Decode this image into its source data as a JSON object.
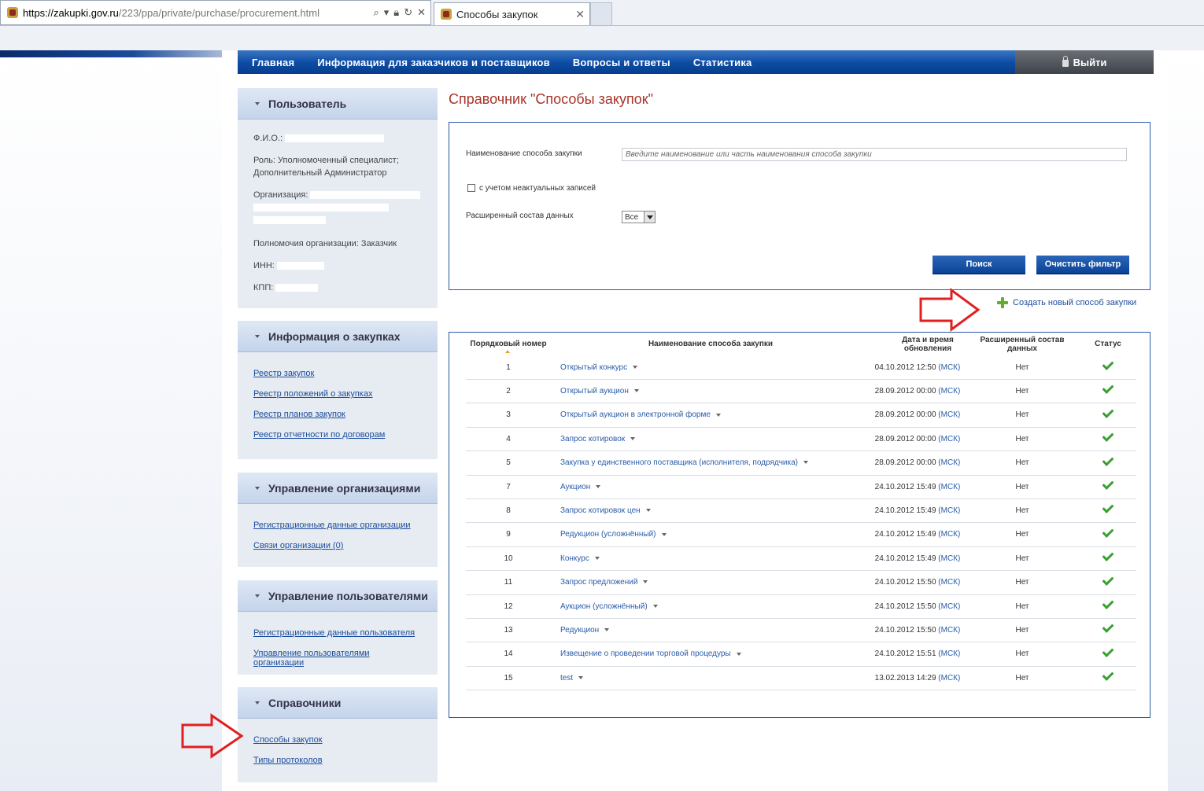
{
  "browser": {
    "url_host": "https://zakupki.gov.ru",
    "url_path": "/223/ppa/private/purchase/procurement.html",
    "tab_title": "Способы закупок"
  },
  "nav": {
    "items": [
      "Главная",
      "Информация для заказчиков и поставщиков",
      "Вопросы и ответы",
      "Статистика"
    ],
    "logout": "Выйти"
  },
  "sidebar": {
    "user": {
      "title": "Пользователь",
      "fio_label": "Ф.И.О.:",
      "role": "Роль: Уполномоченный специалист; Дополнительный Администратор",
      "org_label": "Организация:",
      "authority": "Полномочия организации: Заказчик",
      "inn_label": "ИНН:",
      "kpp_label": "КПП:"
    },
    "purchases": {
      "title": "Информация о закупках",
      "links": [
        "Реестр закупок",
        "Реестр положений о закупках",
        "Реестр планов закупок",
        "Реестр отчетности по договорам"
      ]
    },
    "org_mgmt": {
      "title": "Управление организациями",
      "links": [
        "Регистрационные данные организации",
        "Связи организации (0)"
      ]
    },
    "user_mgmt": {
      "title": "Управление пользователями",
      "links": [
        "Регистрационные данные пользователя",
        "Управление пользователями организации"
      ]
    },
    "refs": {
      "title": "Справочники",
      "links": [
        "Способы закупок",
        "Типы протоколов"
      ]
    }
  },
  "main": {
    "title": "Справочник \"Способы закупок\"",
    "filter": {
      "name_label": "Наименование способа закупки",
      "name_placeholder": "Введите наименование или часть наименования способа закупки",
      "inactive_label": "с учетом неактуальных записей",
      "extended_label": "Расширенный состав данных",
      "extended_value": "Все",
      "search_button": "Поиск",
      "clear_button": "Очистить фильтр"
    },
    "create_link": "Создать новый способ закупки",
    "table": {
      "headers": [
        "Порядковый номер",
        "Наименование способа закупки",
        "Дата и время обновления",
        "Расширенный состав данных",
        "Статус"
      ],
      "tz": "(МСК)",
      "rows": [
        {
          "num": "1",
          "name": "Открытый конкурс",
          "date": "04.10.2012 12:50",
          "ext": "Нет"
        },
        {
          "num": "2",
          "name": "Открытый аукцион",
          "date": "28.09.2012 00:00",
          "ext": "Нет"
        },
        {
          "num": "3",
          "name": "Открытый аукцион в электронной форме",
          "date": "28.09.2012 00:00",
          "ext": "Нет"
        },
        {
          "num": "4",
          "name": "Запрос котировок",
          "date": "28.09.2012 00:00",
          "ext": "Нет"
        },
        {
          "num": "5",
          "name": "Закупка у единственного поставщика (исполнителя, подрядчика)",
          "date": "28.09.2012 00:00",
          "ext": "Нет"
        },
        {
          "num": "7",
          "name": "Аукцион",
          "date": "24.10.2012 15:49",
          "ext": "Нет"
        },
        {
          "num": "8",
          "name": "Запрос котировок цен",
          "date": "24.10.2012 15:49",
          "ext": "Нет"
        },
        {
          "num": "9",
          "name": "Редукцион (усложнённый)",
          "date": "24.10.2012 15:49",
          "ext": "Нет"
        },
        {
          "num": "10",
          "name": "Конкурс",
          "date": "24.10.2012 15:49",
          "ext": "Нет"
        },
        {
          "num": "11",
          "name": "Запрос предложений",
          "date": "24.10.2012 15:50",
          "ext": "Нет"
        },
        {
          "num": "12",
          "name": "Аукцион (усложнённый)",
          "date": "24.10.2012 15:50",
          "ext": "Нет"
        },
        {
          "num": "13",
          "name": "Редукцион",
          "date": "24.10.2012 15:50",
          "ext": "Нет"
        },
        {
          "num": "14",
          "name": "Извещение о проведении торговой процедуры",
          "date": "24.10.2012 15:51",
          "ext": "Нет"
        },
        {
          "num": "15",
          "name": "test",
          "date": "13.02.2013 14:29",
          "ext": "Нет"
        }
      ]
    }
  },
  "colors": {
    "nav_blue": "#0e4ea6",
    "title_red": "#a8342a",
    "link_blue": "#1a4c9c",
    "status_green": "#3aa032",
    "annotation_red": "#e02020"
  }
}
